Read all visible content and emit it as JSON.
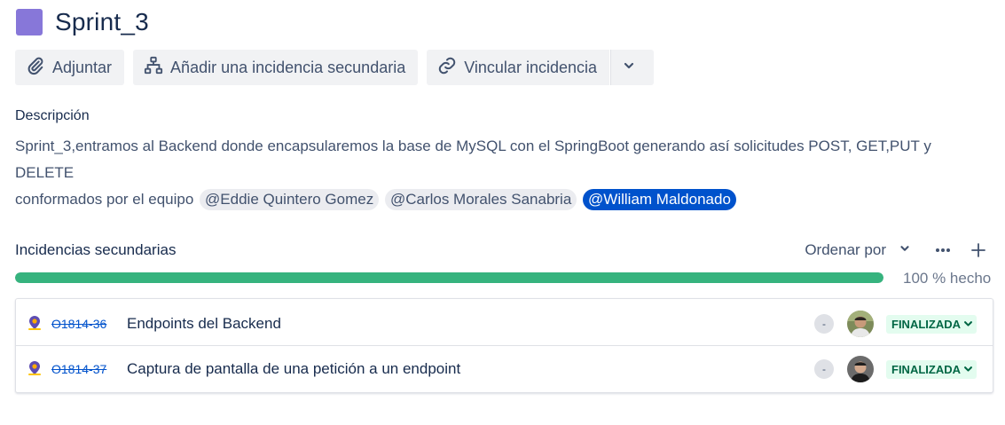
{
  "header": {
    "title": "Sprint_3",
    "epic_color": "#8777d9"
  },
  "toolbar": {
    "attach_label": "Adjuntar",
    "add_child_label": "Añadir una incidencia secundaria",
    "link_label": "Vincular incidencia",
    "attach_icon": "paperclip-icon",
    "add_child_icon": "hierarchy-icon",
    "link_icon": "link-icon",
    "more_icon": "chevron-down-icon"
  },
  "description": {
    "label": "Descripción",
    "text_line1": "Sprint_3,entramos al Backend donde encapsularemos la base de MySQL con el SpringBoot generando así solicitudes POST, GET,PUT y DELETE",
    "text_prefix": "conformados por el equipo",
    "mentions": [
      "@Eddie Quintero Gomez",
      "@Carlos Morales Sanabria",
      "@William Maldonado"
    ]
  },
  "child_issues": {
    "title": "Incidencias secundarias",
    "sort_label": "Ordenar por",
    "progress_fraction": 1.0,
    "progress_label": "100 % hecho",
    "progress_color": "#36b37e",
    "items": [
      {
        "key": "O1814-36",
        "summary": "Endpoints del Backend",
        "priority": "-",
        "status": "FINALIZADA",
        "status_color": "#006644"
      },
      {
        "key": "O1814-37",
        "summary": "Captura de pantalla de una petición a un endpoint",
        "priority": "-",
        "status": "FINALIZADA",
        "status_color": "#006644"
      }
    ]
  }
}
